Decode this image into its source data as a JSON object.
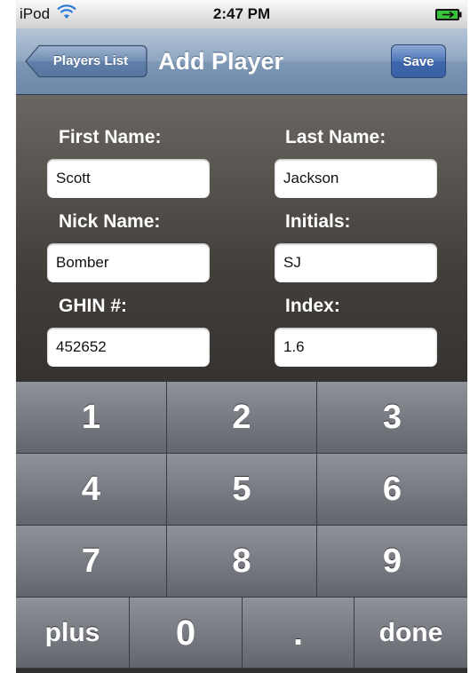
{
  "status_bar": {
    "carrier": "iPod",
    "time": "2:47 PM",
    "icons": [
      "wifi-icon",
      "battery-icon"
    ]
  },
  "navbar": {
    "back_label": "Players List",
    "title": "Add Player",
    "save_label": "Save"
  },
  "form": {
    "first_name_label": "First Name:",
    "first_name_value": "Scott",
    "last_name_label": "Last Name:",
    "last_name_value": "Jackson",
    "nick_name_label": "Nick Name:",
    "nick_name_value": "Bomber",
    "initials_label": "Initials:",
    "initials_value": "SJ",
    "ghin_label": "GHIN #:",
    "ghin_value": "452652",
    "index_label": "Index:",
    "index_value": "1.6"
  },
  "keypad": {
    "rows": [
      [
        "1",
        "2",
        "3"
      ],
      [
        "4",
        "5",
        "6"
      ],
      [
        "7",
        "8",
        "9"
      ]
    ],
    "bottom": [
      "plus",
      "0",
      ".",
      "done"
    ]
  },
  "colors": {
    "navbar": "#7d97b5",
    "save_button": "#4d75b8",
    "form_background": "#433f3b",
    "key": "#62666c"
  }
}
